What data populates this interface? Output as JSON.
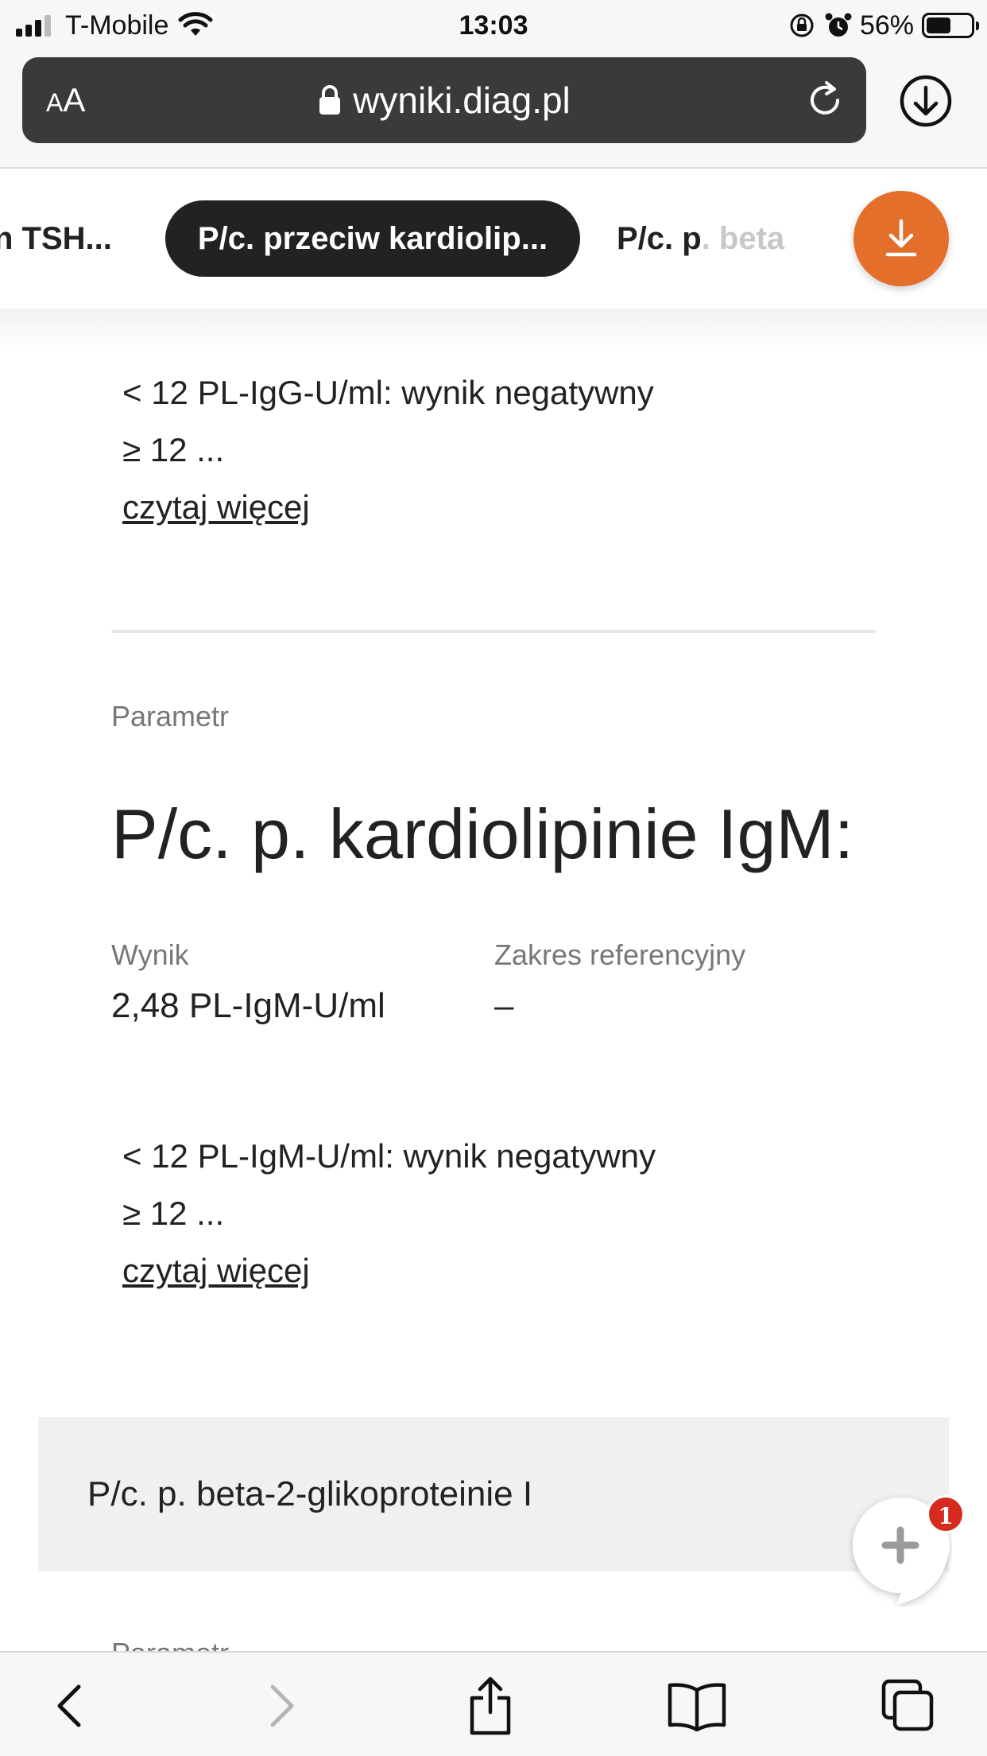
{
  "status_bar": {
    "carrier": "T-Mobile",
    "time": "13:03",
    "battery_percent": "56%",
    "battery_level": 0.56
  },
  "browser": {
    "text_size_button": {
      "small": "A",
      "large": "A"
    },
    "url": "wyniki.diag.pl",
    "icons": [
      "lock-icon",
      "reload-icon",
      "download-icon"
    ]
  },
  "tabs": {
    "left_label": "n TSH...",
    "active_label": "P/c. przeciw kardiolip...",
    "right_label": {
      "visible": "P/c. p",
      "faded": ". beta"
    },
    "download_fab_icon": "download-icon",
    "accent_color": "#e36f2a"
  },
  "previous_card": {
    "note_line1": "< 12 PL-IgG-U/ml: wynik negatywny",
    "note_line2": "≥ 12 ...",
    "read_more": "czytaj więcej"
  },
  "parameter": {
    "label": "Parametr",
    "title": "P/c. p. kardiolipinie IgM:",
    "result_label": "Wynik",
    "result_value": "2,48 PL-IgM-U/ml",
    "reference_label": "Zakres referencyjny",
    "reference_value": "–",
    "note_line1": "< 12 PL-IgM-U/ml: wynik negatywny",
    "note_line2": "≥ 12 ...",
    "read_more": "czytaj więcej"
  },
  "next_section": {
    "title": "P/c. p. beta-2-glikoproteinie I",
    "partial_label": "Parametr"
  },
  "chat": {
    "icon": "plus-icon",
    "badge_count": "1",
    "badge_color": "#d62b1f"
  },
  "toolbar": {
    "icons": [
      "back-icon",
      "forward-icon",
      "share-icon",
      "bookmarks-icon",
      "tabs-icon"
    ]
  }
}
